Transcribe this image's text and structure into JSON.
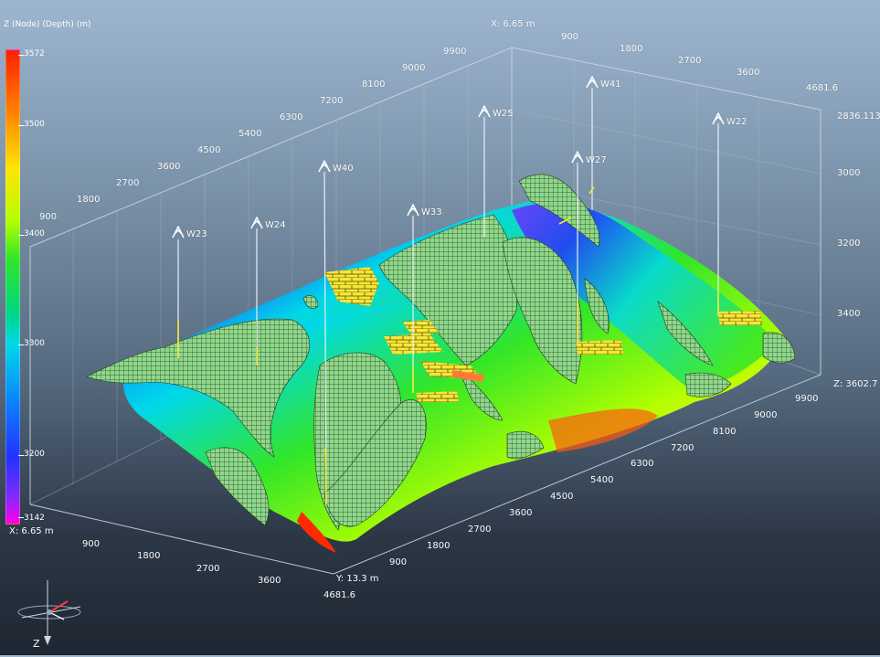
{
  "legend": {
    "title": "Z (Node) (Depth) (m)",
    "ticks": [
      "3572",
      "3500",
      "3400",
      "3300",
      "3200",
      "3142"
    ]
  },
  "axes": {
    "x_axis_title_top": "X: 6.65 m",
    "x_axis_title_bottom": "X: 6.65 m",
    "y_axis_title": "Y: 13.3 m",
    "z_axis_title": "Z: 3602.7 m",
    "left_back_ticks": [
      "900",
      "1800",
      "2700",
      "3600",
      "4500",
      "5400",
      "6300",
      "7200",
      "8100",
      "9000",
      "9900"
    ],
    "top_back_ticks": [
      "900",
      "1800",
      "2700",
      "3600",
      "4681.6"
    ],
    "right_z_ticks": [
      "2836.113",
      "3000",
      "3200",
      "3400"
    ],
    "bottom_front_ticks": [
      "900",
      "1800",
      "2700",
      "3600",
      "4681.6"
    ],
    "right_front_ticks": [
      "900",
      "1800",
      "2700",
      "3600",
      "4500",
      "5400",
      "6300",
      "7200",
      "8100",
      "9000",
      "9900"
    ]
  },
  "wells": [
    {
      "name": "W23"
    },
    {
      "name": "W24"
    },
    {
      "name": "W40"
    },
    {
      "name": "W33"
    },
    {
      "name": "W25"
    },
    {
      "name": "W27"
    },
    {
      "name": "W41"
    },
    {
      "name": "W22"
    }
  ],
  "orientation": {
    "z_label": "Z"
  },
  "colors": {
    "depth_high": "#ff1e00",
    "depth_mid": "#32e628",
    "depth_low": "#ff00e6",
    "mesh": "#8fd88a",
    "well_marker": "#f5e63a"
  }
}
